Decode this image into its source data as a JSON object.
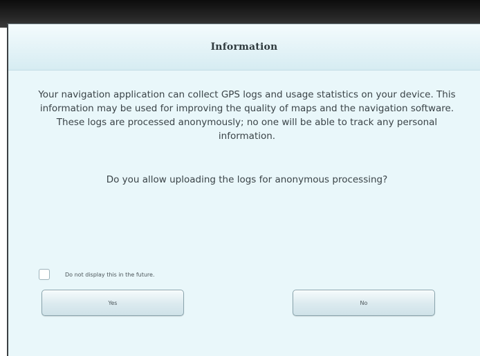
{
  "dialog": {
    "title": "Information",
    "body": "Your navigation application can collect GPS logs and usage statistics on your device. This information may be used for improving the quality of maps and the navigation software. These logs are processed anonymously; no one will be able to track any personal information.",
    "question": "Do you allow uploading the logs for anonymous processing?",
    "checkbox_label": "Do not display this in the future.",
    "checkbox_checked": false,
    "yes_label": "Yes",
    "no_label": "No"
  }
}
